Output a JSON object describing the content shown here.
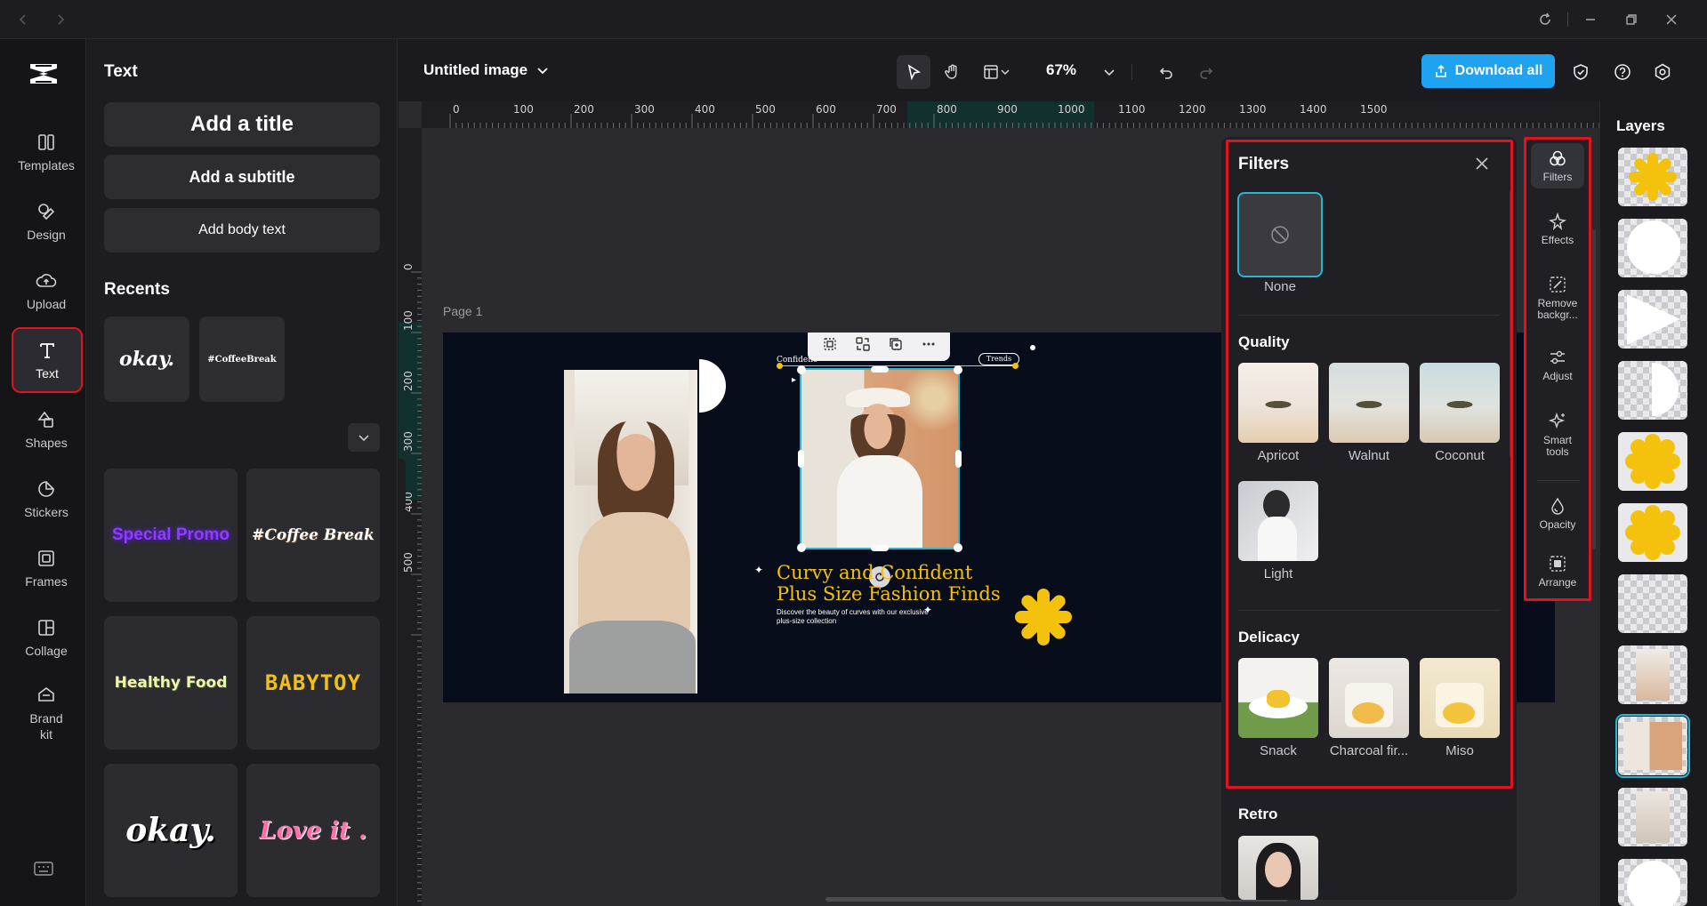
{
  "colors": {
    "accent": "#1fa2ef",
    "highlight": "#e0141e",
    "selection": "#27b7d3",
    "canvas_bg": "#070d1a",
    "brand_yellow": "#f4c20d"
  },
  "nav": {
    "items": [
      {
        "label": "Templates",
        "icon": "templates-icon"
      },
      {
        "label": "Design",
        "icon": "design-icon"
      },
      {
        "label": "Upload",
        "icon": "upload-icon"
      },
      {
        "label": "Text",
        "icon": "text-icon"
      },
      {
        "label": "Shapes",
        "icon": "shapes-icon"
      },
      {
        "label": "Stickers",
        "icon": "stickers-icon"
      },
      {
        "label": "Frames",
        "icon": "frames-icon"
      },
      {
        "label": "Collage",
        "icon": "collage-icon"
      },
      {
        "label": "Brand\nkit",
        "icon": "brand-kit-icon"
      }
    ],
    "active": "Text"
  },
  "text_panel": {
    "title": "Text",
    "add_title": "Add a title",
    "add_subtitle": "Add a subtitle",
    "add_body": "Add body text",
    "recents_title": "Recents",
    "recents": [
      "okay.",
      "#CoffeeBreak"
    ],
    "styles": [
      "Special Promo",
      "#Coffee Break",
      "Healthy Food",
      "BABYTOY",
      "okay.",
      "Love it ."
    ]
  },
  "toolbar": {
    "doc_title": "Untitled image",
    "zoom": "67%",
    "download": "Download all"
  },
  "ruler": {
    "h": [
      "0",
      "100",
      "200",
      "300",
      "400",
      "500",
      "600",
      "700",
      "800",
      "900",
      "1000",
      "1100",
      "1200",
      "1300",
      "1400",
      "1500"
    ],
    "v": [
      "0",
      "100",
      "200",
      "300",
      "400",
      "500"
    ]
  },
  "canvas": {
    "page_label": "Page 1",
    "headline_1": "Curvy and Confident",
    "headline_2": "Plus Size Fashion Finds",
    "body_1": "Discover the beauty of curves with our exclusive",
    "body_2": "plus-size collection",
    "tag_small": "Confidenc",
    "trends": "Trends"
  },
  "filters": {
    "title": "Filters",
    "none_label": "None",
    "sections": [
      {
        "name": "Quality",
        "items": [
          "Apricot",
          "Walnut",
          "Coconut",
          "Light"
        ]
      },
      {
        "name": "Delicacy",
        "items": [
          "Snack",
          "Charcoal fir...",
          "Miso"
        ]
      },
      {
        "name": "Retro",
        "items": []
      }
    ]
  },
  "rail": {
    "items": [
      {
        "label": "Filters",
        "icon": "filters-icon"
      },
      {
        "label": "Effects",
        "icon": "effects-icon"
      },
      {
        "label": "Remove\nbackgr...",
        "icon": "remove-bg-icon"
      },
      {
        "label": "Adjust",
        "icon": "adjust-icon"
      },
      {
        "label": "Smart\ntools",
        "icon": "smart-tools-icon"
      },
      {
        "label": "Opacity",
        "icon": "opacity-icon"
      },
      {
        "label": "Arrange",
        "icon": "arrange-icon"
      }
    ]
  },
  "layers": {
    "title": "Layers"
  }
}
